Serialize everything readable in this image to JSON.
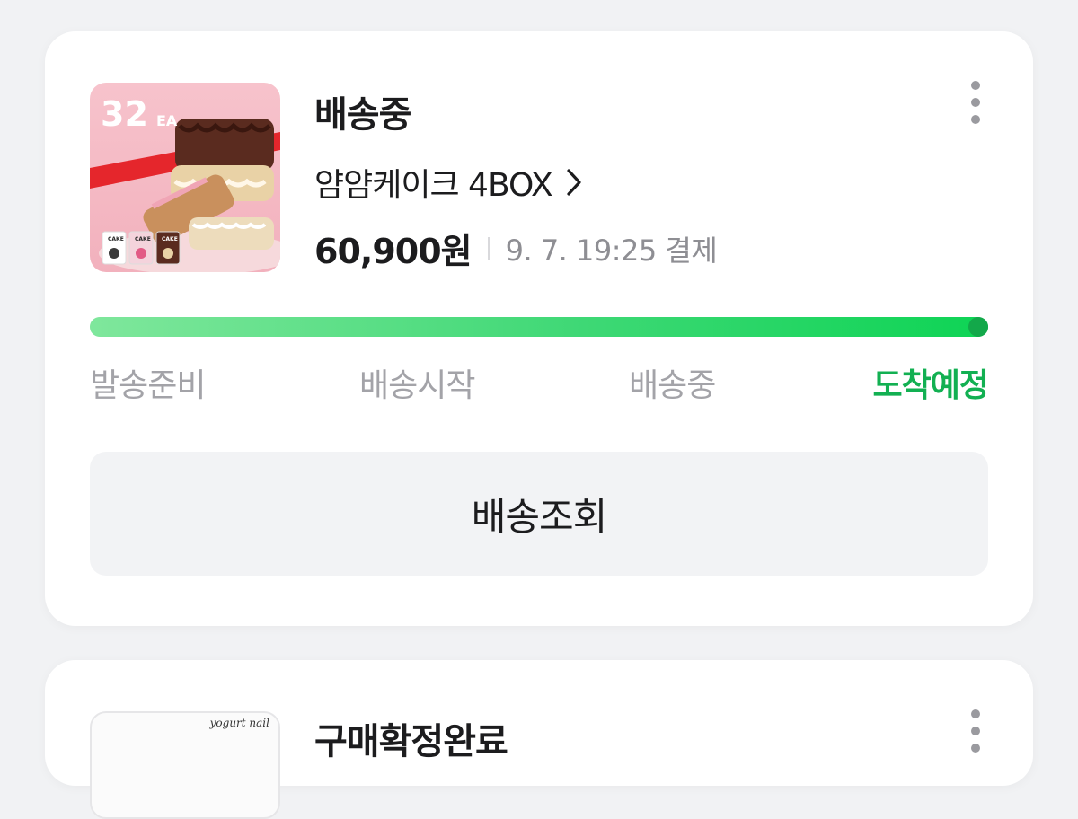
{
  "order1": {
    "thumbnail": {
      "badge_number": "32",
      "badge_unit": "EA",
      "pack_labels": [
        "CAKE",
        "CAKE",
        "CAKE"
      ],
      "alt": "얌얌케이크 상품 이미지"
    },
    "status": "배송중",
    "product_name": "얌얌케이크 4BOX",
    "price": "60,900원",
    "paid_info": "9. 7. 19:25 결제",
    "progress": 1.0,
    "steps": [
      "발송준비",
      "배송시작",
      "배송중",
      "도착예정"
    ],
    "active_step": 3,
    "track_button_label": "배송조회"
  },
  "order2": {
    "thumbnail_text": "yogurt nail",
    "status": "구매확정완료"
  },
  "colors": {
    "background": "#f1f2f4",
    "card": "#ffffff",
    "progress_start": "#7fe79c",
    "progress_end": "#0ed455",
    "active_step": "#12b052",
    "inactive_step": "#a3a3a8",
    "button_bg": "#f2f3f5"
  },
  "icons": {
    "more": "more-vertical-icon",
    "chevron": "chevron-right-icon"
  }
}
